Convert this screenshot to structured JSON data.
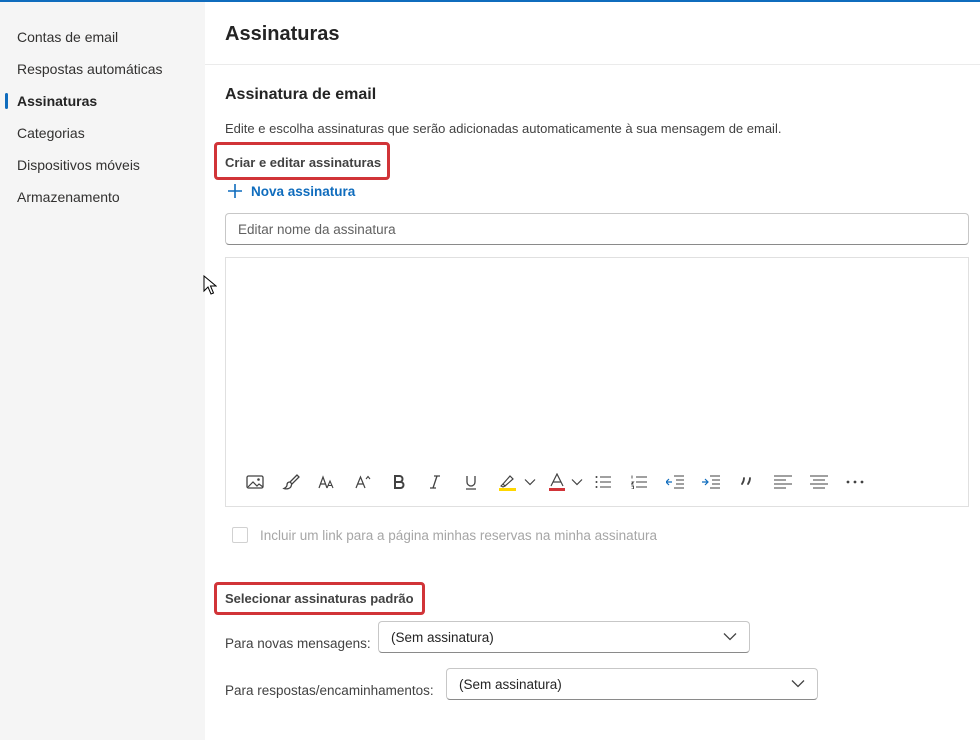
{
  "sidebar": {
    "items": [
      {
        "label": "Contas de email"
      },
      {
        "label": "Respostas automáticas"
      },
      {
        "label": "Assinaturas",
        "active": true
      },
      {
        "label": "Categorias"
      },
      {
        "label": "Dispositivos móveis"
      },
      {
        "label": "Armazenamento"
      }
    ]
  },
  "main": {
    "title": "Assinaturas",
    "section_title": "Assinatura de email",
    "description": "Edite e escolha assinaturas que serão adicionadas automaticamente à sua mensagem de email.",
    "create_heading": "Criar e editar assinaturas",
    "new_signature_label": "Nova assinatura",
    "name_input": {
      "value": "",
      "placeholder": "Editar nome da assinatura"
    },
    "editor": {
      "content": ""
    },
    "toolbar": [
      "insert-image",
      "format-painter",
      "font-size",
      "grow-font",
      "bold",
      "italic",
      "underline",
      "highlight",
      "font-color",
      "bullets",
      "numbering",
      "decrease-indent",
      "increase-indent",
      "quote",
      "align-left",
      "center",
      "more"
    ],
    "include_link_label": "Incluir um link para a página minhas reservas na minha assinatura",
    "include_link_checked": false,
    "defaults_heading": "Selecionar assinaturas padrão",
    "new_messages_label": "Para novas mensagens:",
    "new_messages_value": "(Sem assinatura)",
    "replies_label": "Para respostas/encaminhamentos:",
    "replies_value": "(Sem assinatura)"
  },
  "colors": {
    "accent": "#0f6cbd",
    "highlight_box": "#d13438",
    "highlighter_yellow": "#ffd700",
    "font_color_red": "#d13438"
  }
}
